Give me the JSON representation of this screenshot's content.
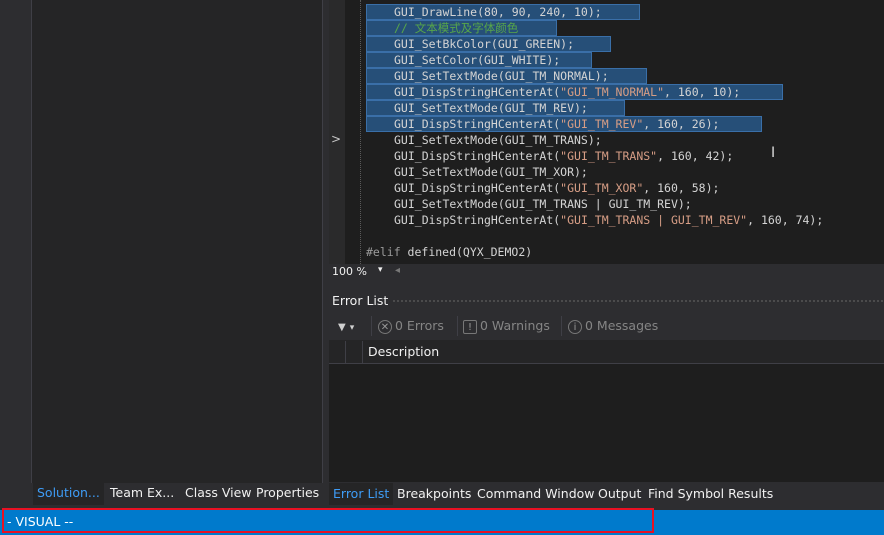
{
  "editor": {
    "lines": [
      {
        "id": "l0",
        "parts": [
          [
            "fn",
            "GUI_DrawLine(80, 90, 240, 10);"
          ]
        ]
      },
      {
        "id": "l1",
        "parts": [
          [
            "cm",
            "// 文本模式及字体颜色"
          ]
        ]
      },
      {
        "id": "l2",
        "parts": [
          [
            "fn",
            "GUI_SetBkColor(GUI_GREEN);"
          ]
        ]
      },
      {
        "id": "l3",
        "parts": [
          [
            "fn",
            "GUI_SetColor(GUI_WHITE);"
          ]
        ]
      },
      {
        "id": "l4",
        "parts": [
          [
            "fn",
            "GUI_SetTextMode(GUI_TM_NORMAL);"
          ]
        ]
      },
      {
        "id": "l5",
        "parts": [
          [
            "fn",
            "GUI_DispStringHCenterAt("
          ],
          [
            "str",
            "\"GUI_TM_NORMAL\""
          ],
          [
            "fn",
            ", 160, 10);"
          ]
        ]
      },
      {
        "id": "l6",
        "parts": [
          [
            "fn",
            "GUI_SetTextMode(GUI_TM_REV);"
          ]
        ]
      },
      {
        "id": "l7",
        "parts": [
          [
            "fn",
            "GUI_DispStringHCenterAt("
          ],
          [
            "str",
            "\"GUI_TM_REV\""
          ],
          [
            "fn",
            ", 160, 26);"
          ]
        ]
      },
      {
        "id": "l8",
        "parts": [
          [
            "fn",
            "GUI_SetTextMode(GUI_TM_TRANS);"
          ]
        ]
      },
      {
        "id": "l9",
        "parts": [
          [
            "fn",
            "GUI_DispStringHCenterAt("
          ],
          [
            "str",
            "\"GUI_TM_TRANS\""
          ],
          [
            "fn",
            ", 160, 42);"
          ]
        ]
      },
      {
        "id": "l10",
        "parts": [
          [
            "fn",
            "GUI_SetTextMode(GUI_TM_XOR);"
          ]
        ]
      },
      {
        "id": "l11",
        "parts": [
          [
            "fn",
            "GUI_DispStringHCenterAt("
          ],
          [
            "str",
            "\"GUI_TM_XOR\""
          ],
          [
            "fn",
            ", 160, 58);"
          ]
        ]
      },
      {
        "id": "l12",
        "parts": [
          [
            "fn",
            "GUI_SetTextMode(GUI_TM_TRANS | GUI_TM_REV);"
          ]
        ]
      },
      {
        "id": "l13",
        "parts": [
          [
            "fn",
            "GUI_DispStringHCenterAt("
          ],
          [
            "str",
            "\"GUI_TM_TRANS | GUI_TM_REV\""
          ],
          [
            "fn",
            ", 160, 74);"
          ]
        ]
      },
      {
        "id": "l14",
        "parts": []
      },
      {
        "id": "l15",
        "parts": [
          [
            "pp",
            "#elif "
          ],
          [
            "fn",
            "defined(QYX_DEMO2)"
          ]
        ]
      }
    ],
    "selected_line_ids": [
      "l0",
      "l1",
      "l2",
      "l3",
      "l4",
      "l5",
      "l6",
      "l7"
    ],
    "glyph_margin_icon": "chevron-right-icon",
    "glyph_margin_symbol": ">",
    "zoom": "100 %",
    "zoom_dropdown_symbol": "▾",
    "hscroll_symbol": "◂",
    "cursor_symbol": "I"
  },
  "error_list": {
    "title": "Error List",
    "filter_icon": "filter-icon",
    "filter_symbol": "▼",
    "filter_dropdown_symbol": "▾",
    "errors_label": "0 Errors",
    "errors_symbol": "✕",
    "warnings_label": "0 Warnings",
    "warnings_symbol": "!",
    "messages_label": "0 Messages",
    "messages_symbol": "i",
    "columns": [
      "Description"
    ]
  },
  "left_tabs": [
    "Solution...",
    "Team Ex...",
    "Class View",
    "Properties"
  ],
  "bottom_tabs": [
    "Error List",
    "Breakpoints",
    "Command Window",
    "Output",
    "Find Symbol Results"
  ],
  "status_bar": {
    "text": "- VISUAL --",
    "color": "#007acc"
  }
}
